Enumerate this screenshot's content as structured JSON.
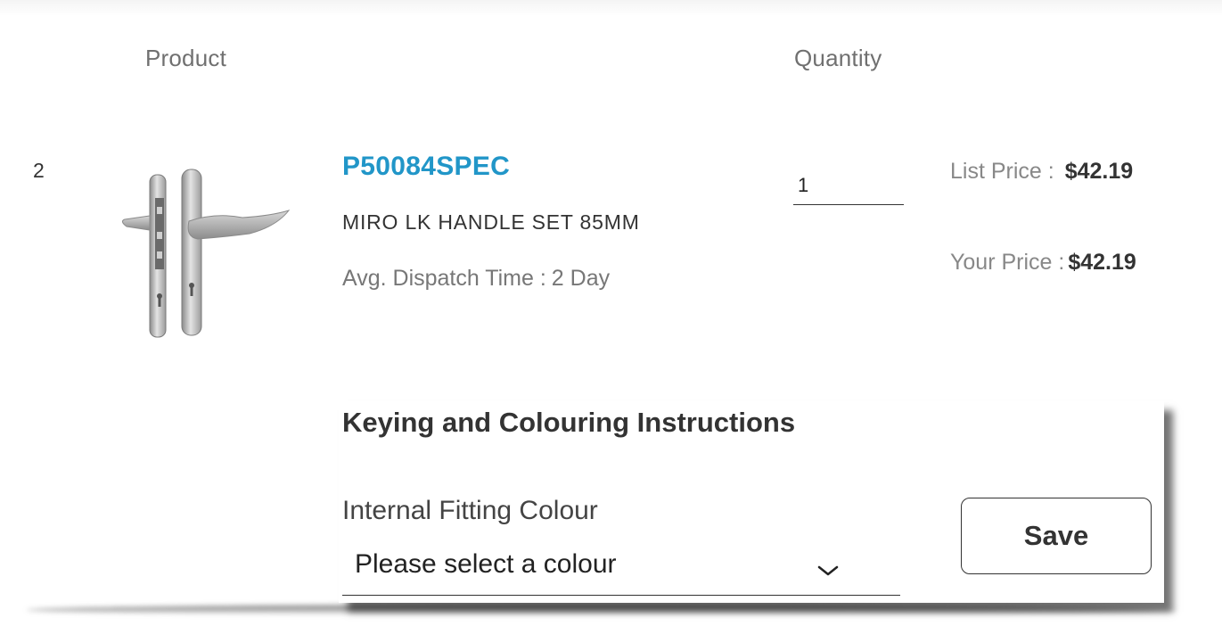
{
  "table": {
    "headers": {
      "product": "Product",
      "quantity": "Quantity"
    }
  },
  "line_item": {
    "index": "2",
    "sku": "P50084SPEC",
    "name": "MIRO LK HANDLE SET 85MM",
    "dispatch_label": "Avg. Dispatch Time :",
    "dispatch_value": "2 Day",
    "quantity": "1",
    "list_price_label": "List Price :",
    "list_price": "$42.19",
    "your_price_label": "Your Price :",
    "your_price": "$42.19",
    "image_icon": "door-handle-set-image"
  },
  "instructions_panel": {
    "title": "Keying and Colouring Instructions",
    "field_label": "Internal Fitting Colour",
    "select_value": "Please select a colour",
    "save_label": "Save"
  },
  "colors": {
    "sku_link": "#2196c8",
    "text": "#333333",
    "muted": "#777777"
  }
}
